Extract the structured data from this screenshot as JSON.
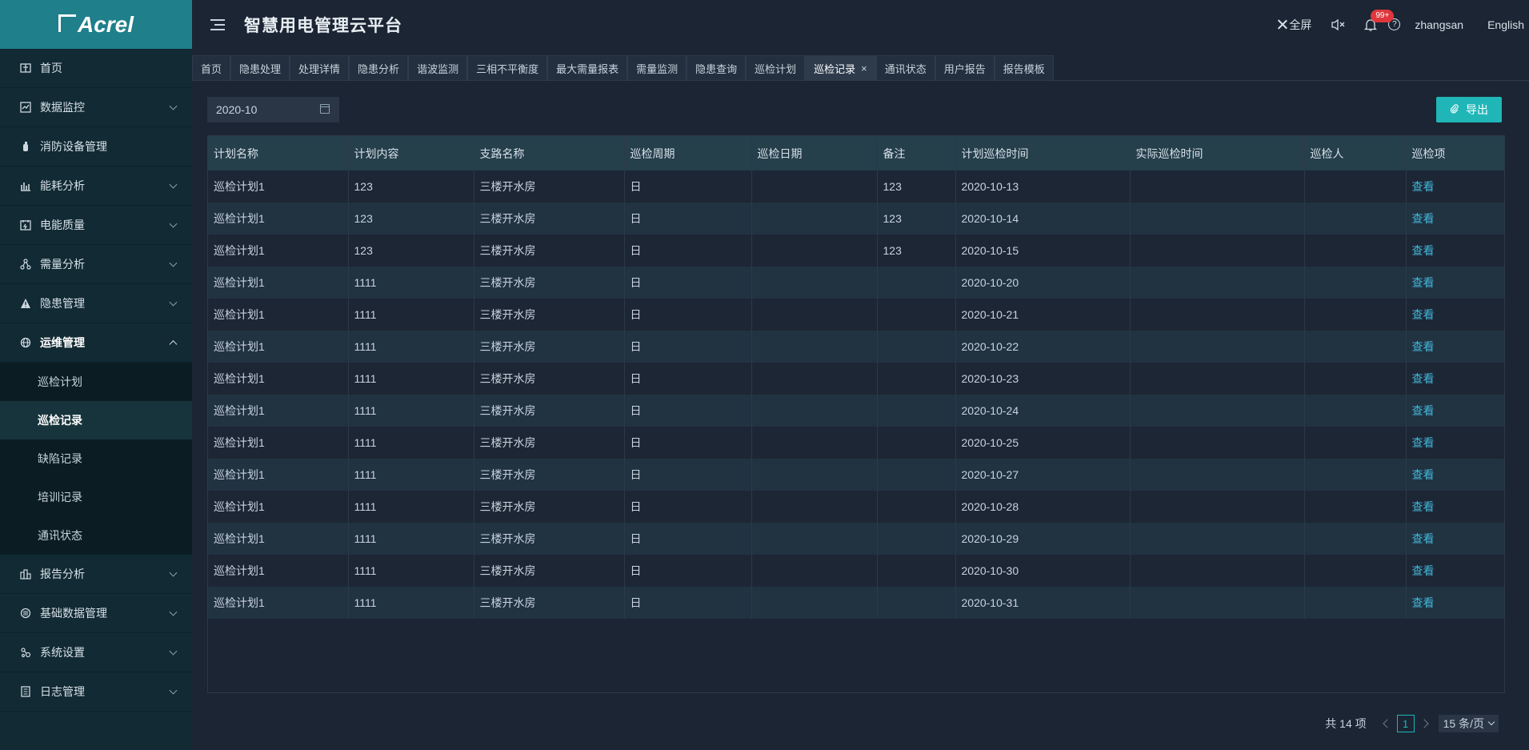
{
  "sidebar": {
    "logo_text": "Acrel",
    "items": [
      {
        "label": "首页",
        "icon": "home-icon",
        "expandable": false
      },
      {
        "label": "数据监控",
        "icon": "monitor-icon",
        "expandable": true
      },
      {
        "label": "消防设备管理",
        "icon": "fire-extinguisher-icon",
        "expandable": false
      },
      {
        "label": "能耗分析",
        "icon": "bar-chart-icon",
        "expandable": true
      },
      {
        "label": "电能质量",
        "icon": "calendar-power-icon",
        "expandable": true
      },
      {
        "label": "需量分析",
        "icon": "network-icon",
        "expandable": true
      },
      {
        "label": "隐患管理",
        "icon": "warning-icon",
        "expandable": true
      },
      {
        "label": "运维管理",
        "icon": "globe-icon",
        "expandable": true,
        "open": true
      }
    ],
    "subitems": [
      {
        "label": "巡检计划",
        "active": false
      },
      {
        "label": "巡检记录",
        "active": true
      },
      {
        "label": "缺陷记录",
        "active": false
      },
      {
        "label": "培训记录",
        "active": false
      },
      {
        "label": "通讯状态",
        "active": false
      }
    ],
    "items_after": [
      {
        "label": "报告分析",
        "icon": "report-icon",
        "expandable": true
      },
      {
        "label": "基础数据管理",
        "icon": "database-icon",
        "expandable": true
      },
      {
        "label": "系统设置",
        "icon": "settings-icon",
        "expandable": true
      },
      {
        "label": "日志管理",
        "icon": "log-icon",
        "expandable": true
      }
    ]
  },
  "header": {
    "title": "智慧用电管理云平台",
    "fullscreen_label": "全屏",
    "notification_badge": "99+",
    "username": "zhangsan",
    "language": "English"
  },
  "tabs": [
    {
      "label": "首页",
      "active": false
    },
    {
      "label": "隐患处理",
      "active": false
    },
    {
      "label": "处理详情",
      "active": false
    },
    {
      "label": "隐患分析",
      "active": false
    },
    {
      "label": "谐波监测",
      "active": false
    },
    {
      "label": "三相不平衡度",
      "active": false
    },
    {
      "label": "最大需量报表",
      "active": false
    },
    {
      "label": "需量监测",
      "active": false
    },
    {
      "label": "隐患查询",
      "active": false
    },
    {
      "label": "巡检计划",
      "active": false
    },
    {
      "label": "巡检记录",
      "active": true,
      "closable": true
    },
    {
      "label": "通讯状态",
      "active": false
    },
    {
      "label": "用户报告",
      "active": false
    },
    {
      "label": "报告模板",
      "active": false
    }
  ],
  "toolbar": {
    "date_value": "2020-10",
    "export_label": "导出"
  },
  "table": {
    "columns": [
      "计划名称",
      "计划内容",
      "支路名称",
      "巡检周期",
      "巡检日期",
      "备注",
      "计划巡检时间",
      "实际巡检时间",
      "巡检人",
      "巡检项"
    ],
    "rows": [
      [
        "巡检计划1",
        "123",
        "三楼开水房",
        "日",
        "",
        "123",
        "2020-10-13",
        "",
        "",
        "查看"
      ],
      [
        "巡检计划1",
        "123",
        "三楼开水房",
        "日",
        "",
        "123",
        "2020-10-14",
        "",
        "",
        "查看"
      ],
      [
        "巡检计划1",
        "123",
        "三楼开水房",
        "日",
        "",
        "123",
        "2020-10-15",
        "",
        "",
        "查看"
      ],
      [
        "巡检计划1",
        "1111",
        "三楼开水房",
        "日",
        "",
        "",
        "2020-10-20",
        "",
        "",
        "查看"
      ],
      [
        "巡检计划1",
        "1111",
        "三楼开水房",
        "日",
        "",
        "",
        "2020-10-21",
        "",
        "",
        "查看"
      ],
      [
        "巡检计划1",
        "1111",
        "三楼开水房",
        "日",
        "",
        "",
        "2020-10-22",
        "",
        "",
        "查看"
      ],
      [
        "巡检计划1",
        "1111",
        "三楼开水房",
        "日",
        "",
        "",
        "2020-10-23",
        "",
        "",
        "查看"
      ],
      [
        "巡检计划1",
        "1111",
        "三楼开水房",
        "日",
        "",
        "",
        "2020-10-24",
        "",
        "",
        "查看"
      ],
      [
        "巡检计划1",
        "1111",
        "三楼开水房",
        "日",
        "",
        "",
        "2020-10-25",
        "",
        "",
        "查看"
      ],
      [
        "巡检计划1",
        "1111",
        "三楼开水房",
        "日",
        "",
        "",
        "2020-10-27",
        "",
        "",
        "查看"
      ],
      [
        "巡检计划1",
        "1111",
        "三楼开水房",
        "日",
        "",
        "",
        "2020-10-28",
        "",
        "",
        "查看"
      ],
      [
        "巡检计划1",
        "1111",
        "三楼开水房",
        "日",
        "",
        "",
        "2020-10-29",
        "",
        "",
        "查看"
      ],
      [
        "巡检计划1",
        "1111",
        "三楼开水房",
        "日",
        "",
        "",
        "2020-10-30",
        "",
        "",
        "查看"
      ],
      [
        "巡检计划1",
        "1111",
        "三楼开水房",
        "日",
        "",
        "",
        "2020-10-31",
        "",
        "",
        "查看"
      ]
    ]
  },
  "pagination": {
    "total_label": "共 14 项",
    "current_page": "1",
    "page_size_label": "15 条/页"
  },
  "colors": {
    "accent": "#20b6b8",
    "link": "#41b6d8",
    "badge": "#e0373c",
    "sidebar_bg": "#112a33",
    "logo_bg": "#1f7f8b"
  }
}
